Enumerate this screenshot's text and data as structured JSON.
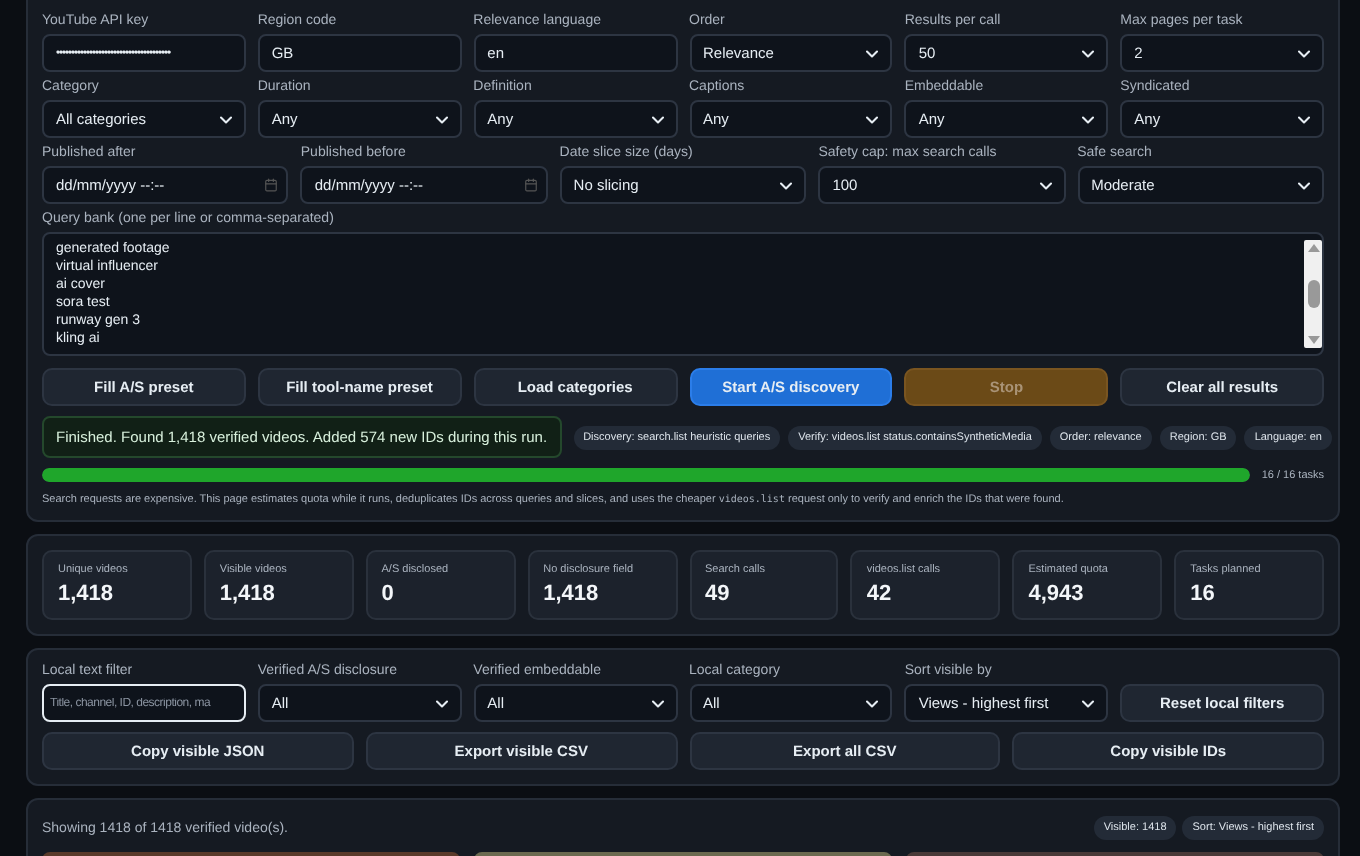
{
  "settings": {
    "grid": [
      [
        {
          "label": "YouTube API key",
          "kind": "password",
          "value": "••••••••••••••••••••••••••••••••••••••"
        },
        {
          "label": "Region code",
          "kind": "text",
          "value": "GB"
        },
        {
          "label": "Relevance language",
          "kind": "text",
          "value": "en"
        },
        {
          "label": "Order",
          "kind": "select",
          "value": "Relevance"
        },
        {
          "label": "Results per call",
          "kind": "select",
          "value": "50"
        },
        {
          "label": "Max pages per task",
          "kind": "select",
          "value": "2"
        }
      ],
      [
        {
          "label": "Category",
          "kind": "select",
          "value": "All categories"
        },
        {
          "label": "Duration",
          "kind": "select",
          "value": "Any"
        },
        {
          "label": "Definition",
          "kind": "select",
          "value": "Any"
        },
        {
          "label": "Captions",
          "kind": "select",
          "value": "Any"
        },
        {
          "label": "Embeddable",
          "kind": "select",
          "value": "Any"
        },
        {
          "label": "Syndicated",
          "kind": "select",
          "value": "Any"
        }
      ]
    ],
    "timing": [
      {
        "label": "Published after",
        "kind": "date",
        "value": "dd/mm/yyyy --:--"
      },
      {
        "label": "Published before",
        "kind": "date",
        "value": "dd/mm/yyyy --:--"
      },
      {
        "label": "Date slice size (days)",
        "kind": "select",
        "value": "No slicing"
      },
      {
        "label": "Safety cap: max search calls",
        "kind": "select",
        "value": "100"
      },
      {
        "label": "Safe search",
        "kind": "select",
        "value": "Moderate"
      }
    ],
    "query_bank": {
      "label": "Query bank (one per line or comma-separated)",
      "lines": [
        "generated footage",
        "virtual influencer",
        "ai cover",
        "sora test",
        "runway gen 3",
        "kling ai"
      ]
    },
    "actions": [
      {
        "label": "Fill A/S preset",
        "kind": "default"
      },
      {
        "label": "Fill tool-name preset",
        "kind": "default"
      },
      {
        "label": "Load categories",
        "kind": "default"
      },
      {
        "label": "Start A/S discovery",
        "kind": "primary"
      },
      {
        "label": "Stop",
        "kind": "disabled"
      },
      {
        "label": "Clear all results",
        "kind": "default"
      }
    ],
    "status": "Finished. Found 1,418 verified videos. Added 574 new IDs during this run.",
    "chips": [
      "Discovery: search.list heuristic queries",
      "Verify: videos.list status.containsSyntheticMedia",
      "Order: relevance",
      "Region: GB",
      "Language: en"
    ],
    "progress": {
      "level": 1,
      "reading": "16 / 16 tasks"
    },
    "note": {
      "before": "Search requests are expensive. This page estimates quota while it runs, deduplicates IDs across queries and slices, and uses the cheaper",
      "code": "videos.list",
      "after": "request only to verify and enrich the IDs that were found."
    }
  },
  "stats": [
    {
      "label": "Unique videos",
      "value": "1,418"
    },
    {
      "label": "Visible videos",
      "value": "1,418"
    },
    {
      "label": "A/S disclosed",
      "value": "0"
    },
    {
      "label": "No disclosure field",
      "value": "1,418"
    },
    {
      "label": "Search calls",
      "value": "49"
    },
    {
      "label": "videos.list calls",
      "value": "42"
    },
    {
      "label": "Estimated quota",
      "value": "4,943"
    },
    {
      "label": "Tasks planned",
      "value": "16"
    }
  ],
  "filters": {
    "fields": [
      {
        "label": "Local text filter",
        "kind": "search",
        "placeholder": "Title, channel, ID, description, ma"
      },
      {
        "label": "Verified A/S disclosure",
        "kind": "select",
        "value": "All"
      },
      {
        "label": "Verified embeddable",
        "kind": "select",
        "value": "All"
      },
      {
        "label": "Local category",
        "kind": "select",
        "value": "All"
      },
      {
        "label": "Sort visible by",
        "kind": "select",
        "value": "Views - highest first"
      }
    ],
    "reset": "Reset local filters",
    "buttons": [
      "Copy visible JSON",
      "Export visible CSV",
      "Export all CSV",
      "Copy visible IDs"
    ]
  },
  "results": {
    "summary": "Showing 1418 of 1418 verified video(s).",
    "chips": [
      "Visible: 1418",
      "Sort: Views - highest first"
    ]
  }
}
